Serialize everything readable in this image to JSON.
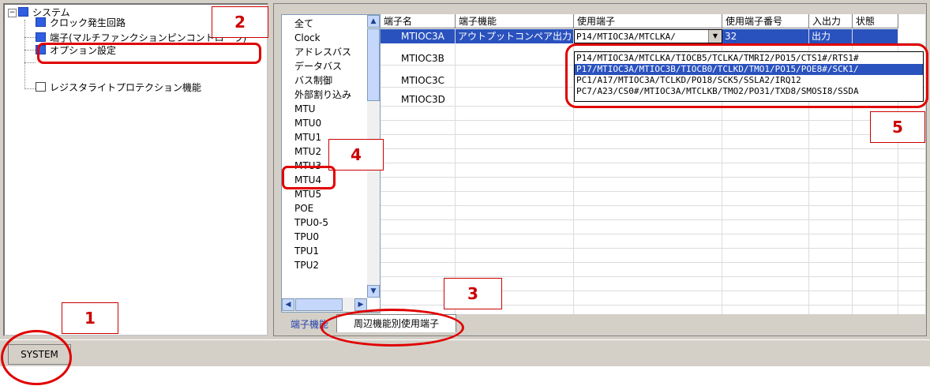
{
  "tree": {
    "expander": "−",
    "root": "システム",
    "items": [
      "クロック発生回路",
      "端子(マルチファンクションピンコントローラ)",
      "オプション設定",
      "レジスタライトプロテクション機能"
    ]
  },
  "categories": [
    "全て",
    "Clock",
    "アドレスバス",
    "データバス",
    "バス制御",
    "外部割り込み",
    "MTU",
    "MTU0",
    "MTU1",
    "MTU2",
    "MTU3",
    "MTU4",
    "MTU5",
    "POE",
    "TPU0-5",
    "TPU0",
    "TPU1",
    "TPU2"
  ],
  "grid": {
    "columns": [
      "端子名",
      "端子機能",
      "使用端子",
      "使用端子番号",
      "入出力",
      "状態"
    ],
    "rows": [
      {
        "pin_name": "MTIOC3A",
        "function": "アウトプットコンペア出力",
        "used_pin": "P14/MTIOC3A/MTCLKA/",
        "pin_no": "32",
        "io": "出力",
        "state": ""
      },
      {
        "pin_name": "MTIOC3B",
        "function": "",
        "used_pin": "",
        "pin_no": "",
        "io": "",
        "state": ""
      },
      {
        "pin_name": "MTIOC3C",
        "function": "",
        "used_pin": "",
        "pin_no": "",
        "io": "",
        "state": ""
      },
      {
        "pin_name": "MTIOC3D",
        "function": "",
        "used_pin": "",
        "pin_no": "",
        "io": "",
        "state": ""
      }
    ]
  },
  "dropdown_options": [
    "P14/MTIOC3A/MTCLKA/TIOCB5/TCLKA/TMRI2/PO15/CTS1#/RTS1#",
    "P17/MTIOC3A/MTIOC3B/TIOCB0/TCLKD/TMO1/PO15/POE8#/SCK1/",
    "PC1/A17/MTIOC3A/TCLKD/PO18/SCK5/SSLA2/IRQ12",
    "PC7/A23/CS0#/MTIOC3A/MTCLKB/TMO2/PO31/TXD8/SMOSI8/SSDA"
  ],
  "tabs": [
    "端子機能",
    "周辺機能別使用端子"
  ],
  "status": {
    "panel": "SYSTEM"
  },
  "callouts": [
    "1",
    "2",
    "3",
    "4",
    "5"
  ],
  "colors": {
    "selection": "#2a52be",
    "highlight_ring": "#e00000",
    "accent": "#2f5fe0"
  }
}
